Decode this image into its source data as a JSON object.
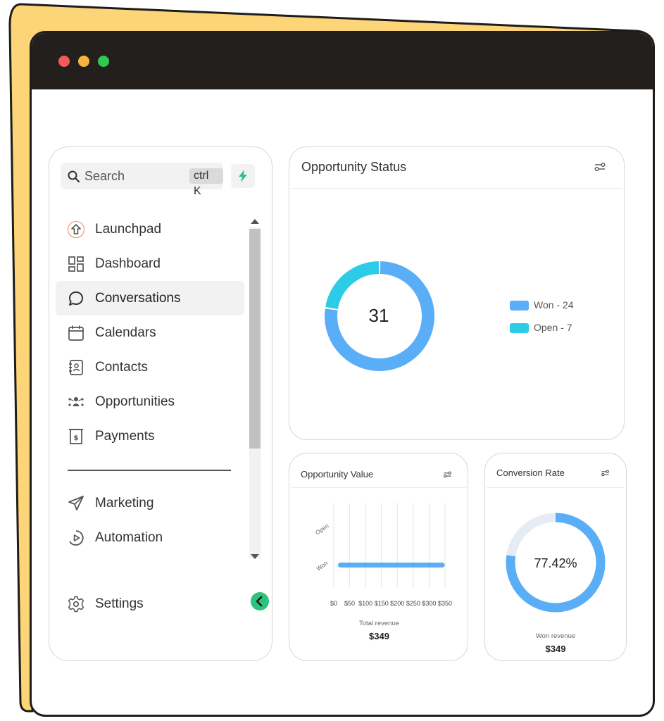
{
  "window": {
    "controls": [
      "close",
      "minimize",
      "maximize"
    ]
  },
  "sidebar": {
    "search": {
      "placeholder": "Search",
      "shortcut": "ctrl K",
      "quick_action_icon": "bolt-icon"
    },
    "nav_items": [
      {
        "label": "Launchpad",
        "icon": "launchpad-icon",
        "active": false
      },
      {
        "label": "Dashboard",
        "icon": "dashboard-icon",
        "active": false
      },
      {
        "label": "Conversations",
        "icon": "chat-bubble-icon",
        "active": true
      },
      {
        "label": "Calendars",
        "icon": "calendar-icon",
        "active": false
      },
      {
        "label": "Contacts",
        "icon": "contacts-icon",
        "active": false
      },
      {
        "label": "Opportunities",
        "icon": "opportunities-icon",
        "active": false
      },
      {
        "label": "Payments",
        "icon": "payments-icon",
        "active": false
      }
    ],
    "nav_items_secondary": [
      {
        "label": "Marketing",
        "icon": "send-icon"
      },
      {
        "label": "Automation",
        "icon": "automation-icon"
      }
    ],
    "settings": {
      "label": "Settings",
      "icon": "gear-icon"
    }
  },
  "opportunity_status": {
    "title": "Opportunity Status",
    "center_value": "31",
    "legend": [
      {
        "label": "Won - 24",
        "color": "#5aaef7"
      },
      {
        "label": "Open - 7",
        "color": "#2ccbe6"
      }
    ]
  },
  "opportunity_value": {
    "title": "Opportunity Value",
    "footer_label": "Total revenue",
    "footer_value": "$349"
  },
  "conversion_rate": {
    "title": "Conversion Rate",
    "center_value": "77.42%",
    "footer_label": "Won revenue",
    "footer_value": "$349"
  },
  "chart_data": [
    {
      "type": "pie",
      "title": "Opportunity Status",
      "categories": [
        "Won",
        "Open"
      ],
      "values": [
        24,
        7
      ],
      "colors": [
        "#5aaef7",
        "#2ccbe6"
      ]
    },
    {
      "type": "bar",
      "orientation": "horizontal",
      "title": "Opportunity Value",
      "categories": [
        "Open",
        "Won"
      ],
      "values": [
        0,
        349
      ],
      "x_ticks": [
        "$0",
        "$50",
        "$100",
        "$150",
        "$200",
        "$250",
        "$300",
        "$350"
      ],
      "xlim": [
        0,
        350
      ],
      "grid": true,
      "color": "#5aaef7"
    },
    {
      "type": "pie",
      "title": "Conversion Rate",
      "values": [
        77.42,
        22.58
      ],
      "colors": [
        "#5aaef7",
        "#e6ecf6"
      ]
    }
  ]
}
